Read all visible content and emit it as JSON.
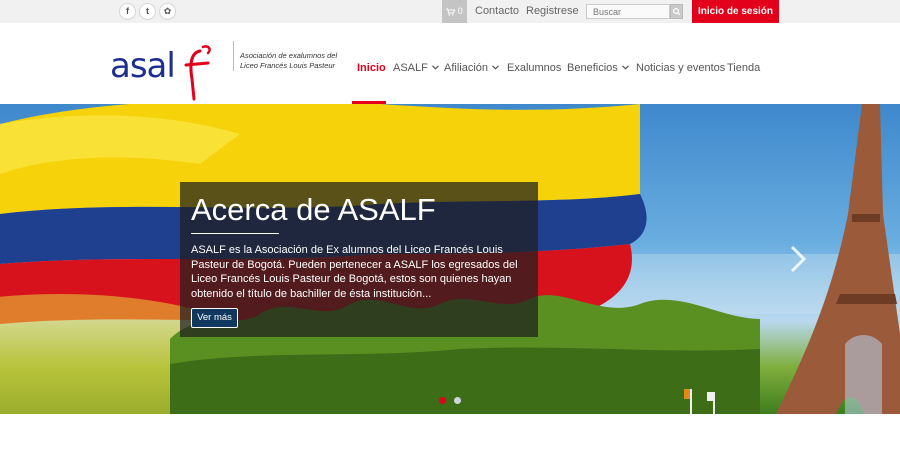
{
  "topbar": {
    "social": [
      {
        "name": "facebook-icon",
        "glyph": "f"
      },
      {
        "name": "twitter-icon",
        "glyph": "t"
      },
      {
        "name": "flickr-icon",
        "glyph": "✿"
      }
    ],
    "cart_count": "0",
    "contact_label": "Contacto",
    "register_label": "Registrese",
    "search_placeholder": "Buscar",
    "login_label": "Inicio de sesión"
  },
  "header": {
    "logo_text": "asalf",
    "tagline_line1": "Asociación de exalumnos del",
    "tagline_line2": "Liceo Francés Louis Pasteur",
    "nav": [
      {
        "label": "Inicio",
        "active": true,
        "dropdown": false
      },
      {
        "label": "ASALF",
        "active": false,
        "dropdown": true
      },
      {
        "label": "Afiliación",
        "active": false,
        "dropdown": true
      },
      {
        "label": "Exalumnos",
        "active": false,
        "dropdown": false
      },
      {
        "label": "Beneficios",
        "active": false,
        "dropdown": true
      },
      {
        "label": "Noticias y eventos",
        "active": false,
        "dropdown": false
      },
      {
        "label": "Tienda",
        "active": false,
        "dropdown": false
      }
    ]
  },
  "hero": {
    "title": "Acerca de ASALF",
    "text": "ASALF es la Asociación de Ex alumnos del Liceo Francés Louis Pasteur de Bogotá. Pueden pertenecer a ASALF los egresados del Liceo Francés Louis Pasteur de Bogotá, estos son quienes hayan obtenido el título de bachiller de ésta institución...",
    "button_label": "Ver más",
    "slides": 2,
    "active_slide": 1
  },
  "colors": {
    "accent": "#e3001b",
    "navy": "#1c2f8f",
    "button_bg": "#11385f"
  }
}
